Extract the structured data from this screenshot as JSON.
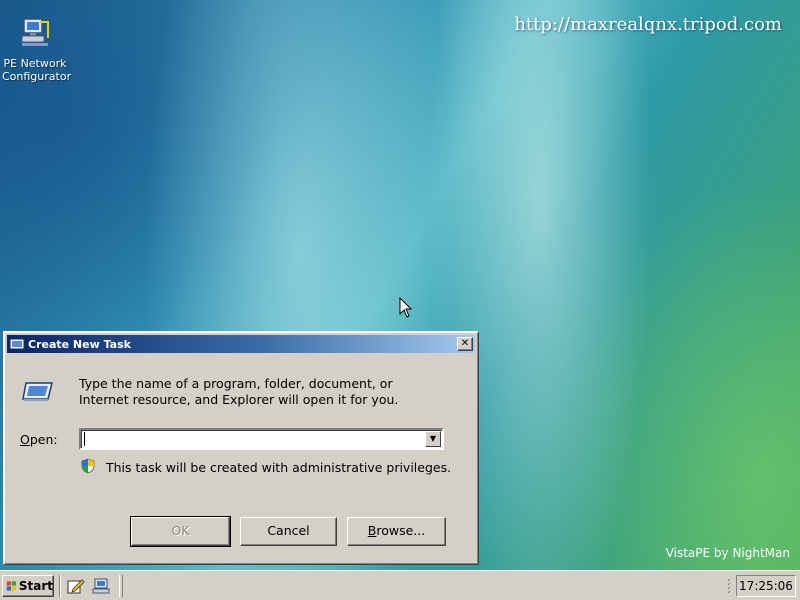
{
  "desktop": {
    "icon_label_line1": "PE Network",
    "icon_label_line2": "Configurator",
    "watermark": "http://maxrealqnx.tripod.com",
    "brand": "VistaPE by NightMan"
  },
  "dialog": {
    "title": "Create New Task",
    "close_symbol": "✕",
    "description_line1": "Type the name of a program, folder, document, or",
    "description_line2": "Internet resource, and Explorer will open it for you.",
    "open_label_mnemonic": "O",
    "open_label_rest": "pen:",
    "open_value": "",
    "dropdown_symbol": "▼",
    "admin_note": "This task will be created with administrative privileges.",
    "ok_label": "OK",
    "cancel_label": "Cancel",
    "browse_mnemonic": "B",
    "browse_rest": "rowse...",
    "ok_enabled": false
  },
  "taskbar": {
    "start_label": "Start",
    "clock": "17:25:06",
    "quick_launch": [
      "edit-icon",
      "network-config-icon"
    ]
  },
  "icons": {
    "desktop": "network-configurator-icon",
    "title": "run-dialog-title-icon",
    "run": "run-program-icon",
    "shield": "uac-shield-icon",
    "start": "windows-logo-icon"
  },
  "colors": {
    "titlebar_start": "#0a246a",
    "titlebar_end": "#a6caf0",
    "dialog_face": "#d4d0c8"
  }
}
